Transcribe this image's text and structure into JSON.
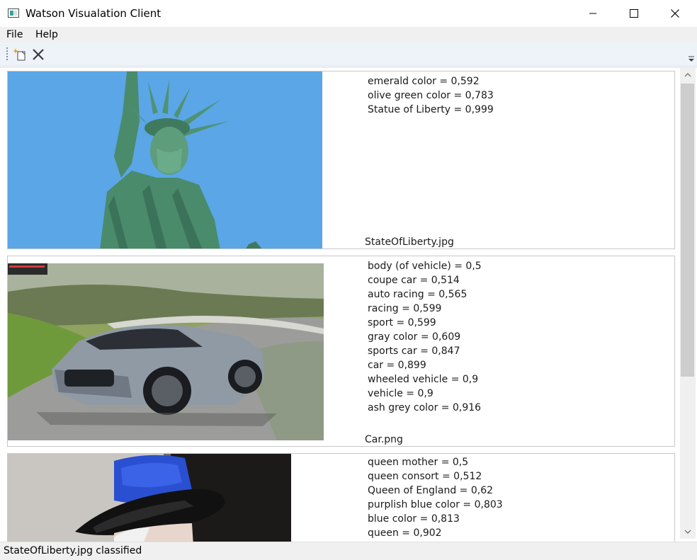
{
  "window": {
    "title": "Watson Visualation Client"
  },
  "menu": {
    "items": [
      "File",
      "Help"
    ]
  },
  "toolbar": {
    "buttons": [
      {
        "icon": "new-document-icon"
      },
      {
        "icon": "close-x-icon"
      }
    ]
  },
  "results": [
    {
      "filename": "StateOfLiberty.jpg",
      "labels": [
        "emerald color = 0,592",
        "olive green color = 0,783",
        "Statue of Liberty = 0,999"
      ]
    },
    {
      "filename": "Car.png",
      "labels": [
        "body (of vehicle) = 0,5",
        "coupe car = 0,514",
        "auto racing = 0,565",
        "racing = 0,599",
        "sport = 0,599",
        "gray color = 0,609",
        "sports car = 0,847",
        "car = 0,899",
        "wheeled vehicle = 0,9",
        "vehicle = 0,9",
        "ash grey color = 0,916"
      ]
    },
    {
      "filename": "",
      "labels": [
        "queen mother = 0,5",
        "queen consort = 0,512",
        "Queen of England = 0,62",
        "purplish blue color = 0,803",
        "blue color = 0,813",
        "queen = 0,902"
      ]
    }
  ],
  "status": {
    "text": "StateOfLiberty.jpg classified"
  },
  "colors": {
    "sky": "#5aa6e6",
    "statue": "#4d8a6e",
    "toolbar_bg": "#eef3fa",
    "hat_blue": "#2a4fd0"
  }
}
